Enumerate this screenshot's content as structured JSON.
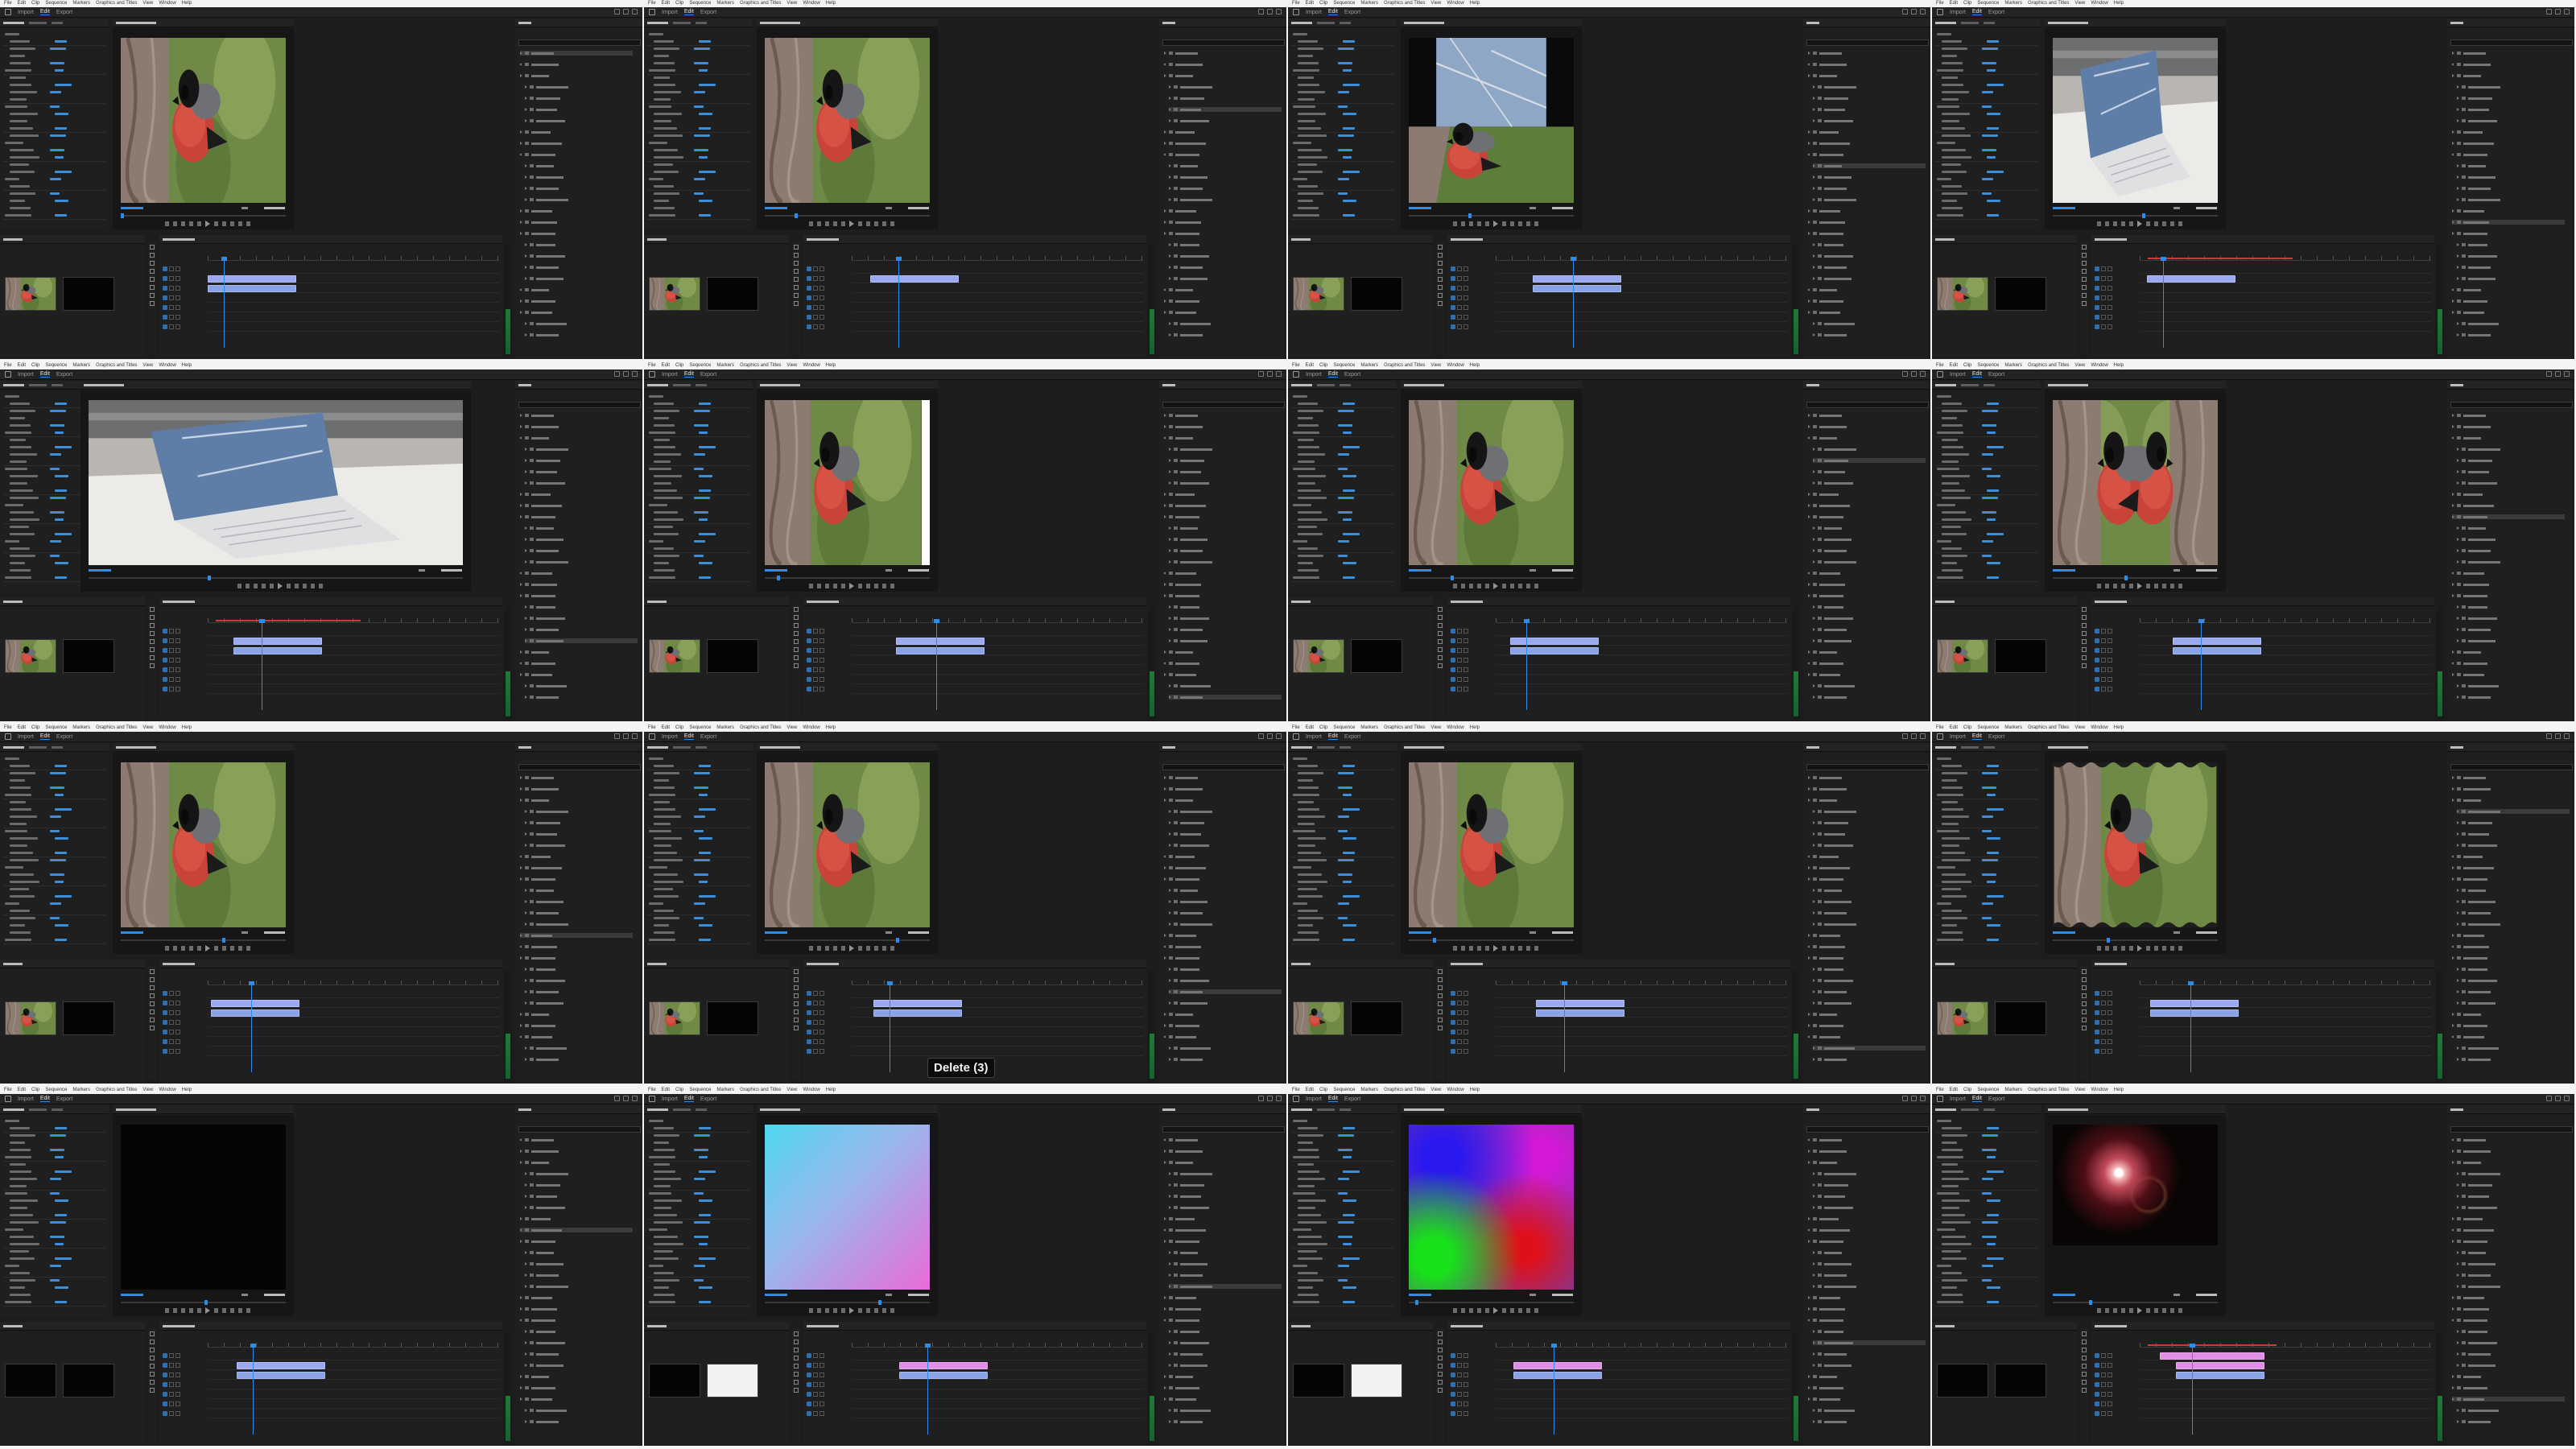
{
  "menu": [
    "File",
    "Edit",
    "Clip",
    "Sequence",
    "Markers",
    "Graphics and Titles",
    "View",
    "Window",
    "Help"
  ],
  "workspace_tabs": [
    "Import",
    "Edit",
    "Export"
  ],
  "tooltip": "Delete (3)",
  "panes": [
    {
      "id": "p1",
      "title": "",
      "ws": "std",
      "frame": "bird",
      "tooltip": false
    },
    {
      "id": "p2",
      "title": "",
      "ws": "std",
      "frame": "bird-3d",
      "tooltip": false
    },
    {
      "id": "p3",
      "title": "",
      "ws": "std",
      "frame": "bird-split",
      "tooltip": false
    },
    {
      "id": "p4",
      "title": "",
      "ws": "std",
      "frame": "laptop",
      "tooltip": false
    },
    {
      "id": "p5",
      "title": "",
      "ws": "wide",
      "frame": "laptop",
      "tooltip": false
    },
    {
      "id": "p6",
      "title": "",
      "ws": "std",
      "frame": "bird-crop",
      "tooltip": false
    },
    {
      "id": "p7",
      "title": "",
      "ws": "std",
      "frame": "bird",
      "tooltip": false
    },
    {
      "id": "p8",
      "title": "",
      "ws": "std",
      "frame": "bird-mirror",
      "tooltip": false
    },
    {
      "id": "p9",
      "title": "",
      "ws": "std",
      "frame": "bird",
      "tooltip": false
    },
    {
      "id": "p10",
      "title": "",
      "ws": "std",
      "frame": "bird",
      "tooltip": true
    },
    {
      "id": "p11",
      "title": "",
      "ws": "std",
      "frame": "bird",
      "tooltip": false
    },
    {
      "id": "p12",
      "title": "",
      "ws": "std",
      "frame": "bird-wave",
      "tooltip": false
    },
    {
      "id": "p13",
      "title": "",
      "ws": "std",
      "frame": "black",
      "tooltip": false
    },
    {
      "id": "p14",
      "title": "",
      "ws": "std",
      "frame": "gradient",
      "tooltip": false
    },
    {
      "id": "p15",
      "title": "",
      "ws": "std",
      "frame": "fourcolor",
      "tooltip": false
    },
    {
      "id": "p16",
      "title": "",
      "ws": "std",
      "frame": "flare",
      "tooltip": false
    }
  ],
  "colors": {
    "accent": "#2d8ceb",
    "clip_video": "#9aa9f0",
    "clip_pink": "#e18ee6",
    "panel_bg": "#1f1f1f",
    "app_bg": "#1d1d1d"
  }
}
